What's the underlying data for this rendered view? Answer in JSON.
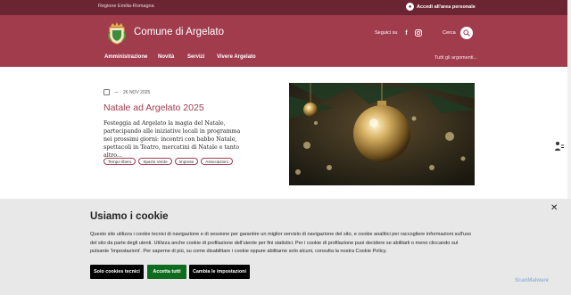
{
  "topbar": {
    "region": "Regione Emilia-Romagna",
    "login": "Accedi all'area personale",
    "login_icon": "user-icon"
  },
  "header": {
    "title": "Comune di Argelato",
    "social_label": "Seguici su",
    "search_label": "Cerca",
    "nav": [
      "Amministrazione",
      "Novità",
      "Servizi",
      "Vivere Argelato"
    ],
    "all_topics": "Tutti gli argomenti..."
  },
  "article": {
    "date": "26 NOV 2025",
    "title": "Natale ad Argelato 2025",
    "text": "Festeggia ad Argelato la magia del Natale, partecipando alle iniziative locali in programma nei prossimi giorni: incontri con babbo Natale, spettacoli in Teatro, mercatini di Natale e tanto altro...",
    "tags": [
      "Tempo libero",
      "Spazio Verde",
      "Imprese",
      "Associazioni"
    ]
  },
  "cookie": {
    "title": "Usiamo i cookie",
    "text": "Questo sito utilizza i cookie tecnici di navigazione e di sessione per garantire un miglior servizio di navigazione del sito, e cookie analitici per raccogliere informazioni sull'uso del sito da parte degli utenti. Utilizza anche cookie di profilazione dell'utente per fini statistici. Per i cookie di profilazione puoi decidere se abilitarli o meno cliccando sul pulsante 'Impostazioni'. Per saperne di più, su come disabilitare i cookie oppure abilitarne solo alcuni, consulta la nostra Cookie Policy.",
    "btn_tech": "Solo cookies tecnici",
    "btn_accept": "Accetta tutti",
    "btn_settings": "Cambia le impostazioni"
  },
  "watermark": "ScanMalware",
  "colors": {
    "brand": "#a13c4d",
    "brand_dark": "#6b2532",
    "accept": "#0f6b1d"
  }
}
